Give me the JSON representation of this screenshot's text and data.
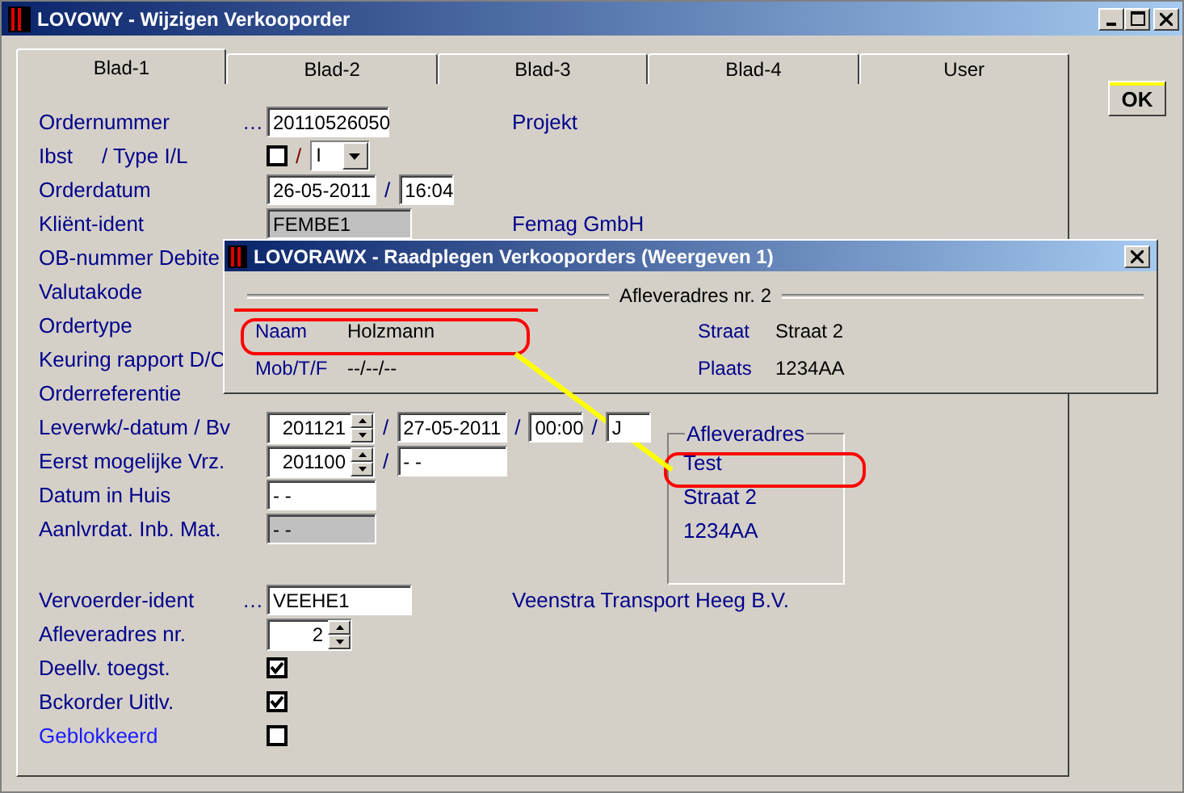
{
  "window": {
    "title": "LOVOWY - Wijzigen Verkooporder"
  },
  "ok_button": "OK",
  "tabs": [
    {
      "label": "Blad-1",
      "selected": true
    },
    {
      "label": "Blad-2",
      "selected": false
    },
    {
      "label": "Blad-3",
      "selected": false
    },
    {
      "label": "Blad-4",
      "selected": false
    },
    {
      "label": "User",
      "selected": false
    }
  ],
  "form_sections": [
    [
      {
        "labels": [
          "Ordernummer"
        ],
        "lookup": "…",
        "items": [
          {
            "kind": "number-field",
            "value": "20110526050",
            "disabled": false
          }
        ],
        "info": "Projekt"
      },
      {
        "labels": [
          "Ibst",
          "/ Type I/L"
        ],
        "items": [
          {
            "kind": "checkbox",
            "checked": false
          },
          {
            "kind": "sep",
            "text": "/",
            "color": "#800000"
          },
          {
            "kind": "dropdown",
            "value": "I"
          }
        ]
      },
      {
        "labels": [
          "Orderdatum"
        ],
        "items": [
          {
            "kind": "date-field",
            "value": "26-05-2011",
            "disabled": false
          },
          {
            "kind": "sep",
            "text": "/",
            "color": "#000080"
          },
          {
            "kind": "time-field",
            "value": "16:04",
            "disabled": false
          }
        ]
      },
      {
        "labels": [
          "Kliënt-ident"
        ],
        "items": [
          {
            "kind": "code-field",
            "value": "FEMBE1",
            "disabled": true
          }
        ],
        "info": "Femag GmbH"
      },
      {
        "labels": [
          "OB-nummer Debite"
        ]
      },
      {
        "labels": [
          "Valutakode"
        ]
      },
      {
        "labels": [
          "Ordertype"
        ]
      },
      {
        "labels": [
          "Keuring rapport D/C"
        ]
      },
      {
        "labels": [
          "Orderreferentie"
        ]
      },
      {
        "labels": [
          "Leverwk/-datum / Bv"
        ],
        "items": [
          {
            "kind": "week-spin",
            "value": "201121"
          },
          {
            "kind": "sep",
            "text": "/",
            "color": "#000080"
          },
          {
            "kind": "date-field",
            "value": "27-05-2011",
            "disabled": false
          },
          {
            "kind": "sep",
            "text": "/",
            "color": "#000080"
          },
          {
            "kind": "time-field",
            "value": "00:00",
            "disabled": false
          },
          {
            "kind": "sep",
            "text": "/",
            "color": "#000080"
          },
          {
            "kind": "flag-field",
            "value": "J",
            "disabled": false
          }
        ]
      },
      {
        "labels": [
          "Eerst mogelijke Vrz."
        ],
        "items": [
          {
            "kind": "week-spin",
            "value": "201100"
          },
          {
            "kind": "sep",
            "text": "/",
            "color": "#000080"
          },
          {
            "kind": "date-field",
            "value": "- -",
            "disabled": false
          }
        ]
      },
      {
        "labels": [
          "Datum in Huis"
        ],
        "items": [
          {
            "kind": "date-field",
            "value": "- -",
            "disabled": false
          }
        ]
      },
      {
        "labels": [
          "Aanlvrdat. Inb. Mat."
        ],
        "items": [
          {
            "kind": "date-field",
            "value": "- -",
            "disabled": true
          }
        ]
      }
    ],
    [
      {
        "labels": [
          "Vervoerder-ident"
        ],
        "lookup": "…",
        "items": [
          {
            "kind": "code-field",
            "value": "VEEHE1",
            "disabled": false
          }
        ],
        "info": "Veenstra Transport Heeg B.V."
      },
      {
        "labels": [
          "Afleveradres nr."
        ],
        "items": [
          {
            "kind": "count-spin",
            "value": "2"
          }
        ]
      },
      {
        "labels": [
          "Deellv. toegst."
        ],
        "items": [
          {
            "kind": "checkbox",
            "checked": true
          }
        ]
      },
      {
        "labels": [
          "Bckorder Uitlv."
        ],
        "items": [
          {
            "kind": "checkbox",
            "checked": true
          }
        ]
      },
      {
        "labels": [
          "Geblokkeerd"
        ],
        "emphasis": true,
        "items": [
          {
            "kind": "checkbox",
            "checked": false
          }
        ]
      }
    ]
  ],
  "address_group": {
    "title": "Afleveradres",
    "lines": [
      "Test",
      "Straat 2",
      "1234AA"
    ]
  },
  "popup": {
    "title": "LOVORAWX - Raadplegen Verkooporders (Weergeven 1)",
    "group_title": "Afleveradres nr. 2",
    "fields": [
      {
        "label": "Naam",
        "value": "Holzmann"
      },
      {
        "label": "Straat",
        "value": "Straat 2"
      },
      {
        "label": "Mob/T/F",
        "value": "--/--/--"
      },
      {
        "label": "Plaats",
        "value": "1234AA"
      }
    ]
  }
}
